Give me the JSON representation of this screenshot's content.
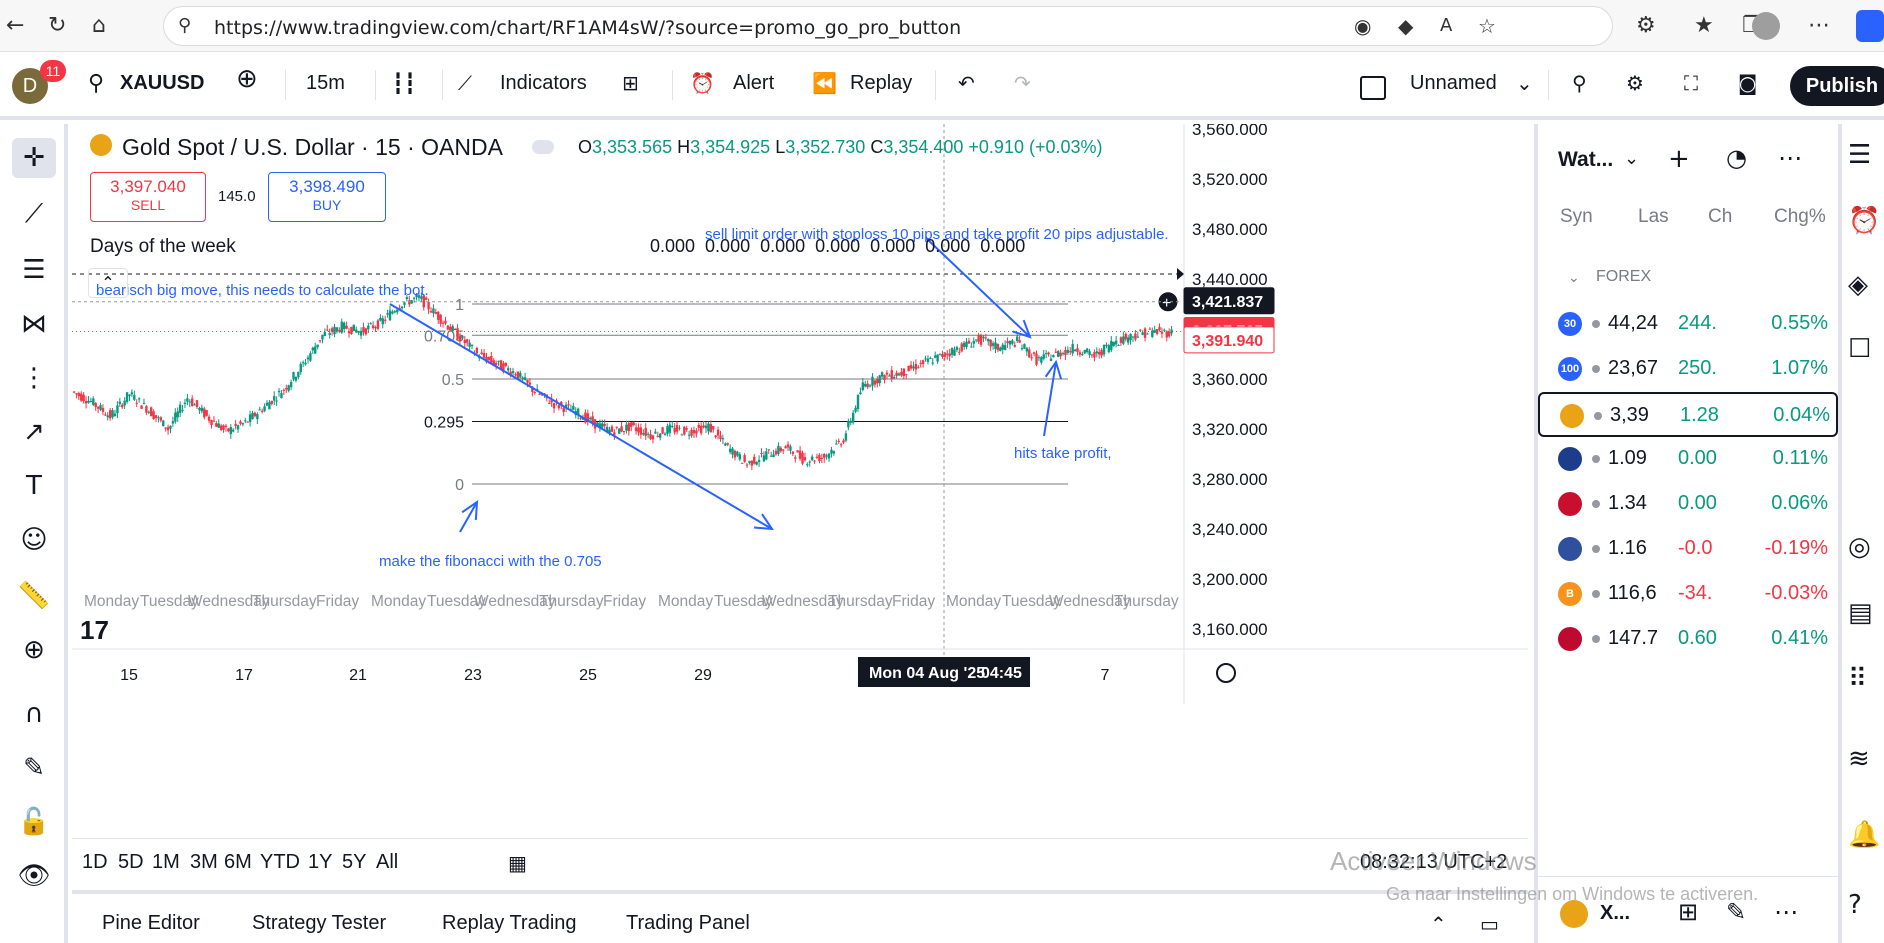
{
  "browser": {
    "url": "https://www.tradingview.com/chart/RF1AM4sW/?source=promo_go_pro_button"
  },
  "toolbar": {
    "avatar_letter": "D",
    "avatar_badge": "11",
    "symbol": "XAUUSD",
    "interval": "15m",
    "indicators_label": "Indicators",
    "alert_label": "Alert",
    "replay_label": "Replay",
    "layout_name": "Unnamed",
    "publish_label": "Publish"
  },
  "legend": {
    "title": "Gold Spot / U.S. Dollar · 15 · OANDA",
    "o_label": "O",
    "o_value": "3,353.565",
    "h_label": "H",
    "h_value": "3,354.925",
    "l_label": "L",
    "l_value": "3,352.730",
    "c_label": "C",
    "c_value": "3,354.400",
    "change": "+0.910 (+0.03%)",
    "sell_price": "3,397.040",
    "sell_label": "SELL",
    "spread": "145.0",
    "buy_price": "3,398.490",
    "buy_label": "BUY",
    "indicator_name": "Days of the week",
    "indicator_values": "0.000  0.000  0.000  0.000  0.000  0.000  0.000"
  },
  "chart_data": {
    "type": "line",
    "title": "Gold Spot / U.S. Dollar · 15 · OANDA",
    "y_ticks": [
      "3,560.000",
      "3,520.000",
      "3,480.000",
      "3,440.000",
      "3,400.000",
      "3,360.000",
      "3,320.000",
      "3,280.000",
      "3,240.000",
      "3,200.000",
      "3,160.000"
    ],
    "x_ticks": [
      "15",
      "17",
      "21",
      "23",
      "25",
      "29",
      "7"
    ],
    "x_highlight": "Mon 04 Aug '25",
    "x_highlight_time": "04:45",
    "day_labels": [
      "Monday",
      "Tuesday",
      "Wednesday",
      "Thursday",
      "Friday",
      "Monday",
      "Tuesday",
      "Wednesday",
      "Thursday",
      "Friday",
      "Monday",
      "Tuesday",
      "Wednesday",
      "Thursday",
      "Friday",
      "Monday",
      "Tuesday",
      "Wednesday",
      "Thursday"
    ],
    "price_labels": {
      "crosshair": "3,421.837",
      "last": "3,397.765",
      "bid": "3,391.940"
    },
    "fib_levels": [
      {
        "label": "1",
        "value": 3420
      },
      {
        "label": "0.705",
        "value": 3395
      },
      {
        "label": "0.5",
        "value": 3360
      },
      {
        "label": "0.295",
        "value": 3326
      },
      {
        "label": "0",
        "value": 3276
      }
    ],
    "approx_close_series": [
      3350,
      3342,
      3330,
      3348,
      3335,
      3320,
      3345,
      3330,
      3318,
      3325,
      3338,
      3352,
      3372,
      3395,
      3402,
      3398,
      3405,
      3420,
      3425,
      3410,
      3395,
      3380,
      3372,
      3365,
      3350,
      3340,
      3335,
      3325,
      3318,
      3322,
      3315,
      3320,
      3318,
      3322,
      3305,
      3292,
      3300,
      3305,
      3295,
      3298,
      3312,
      3355,
      3362,
      3365,
      3372,
      3378,
      3385,
      3392,
      3385,
      3390,
      3375,
      3380,
      3385,
      3378,
      3390,
      3395,
      3398,
      3397
    ]
  },
  "annotations": {
    "bearish": "bearisch big move, this needs to calculate the bot.",
    "sell_limit": "sell limit order with stoploss 10 pips and take profit 20 pips  adjustable.",
    "take_profit": "hits take profit,",
    "fibonacci": "make the fibonacci with the 0.705"
  },
  "timeframes": [
    "1D",
    "5D",
    "1M",
    "3M",
    "6M",
    "YTD",
    "1Y",
    "5Y",
    "All"
  ],
  "clock": "08:32:13 UTC+2",
  "bottom_tabs": [
    "Pine Editor",
    "Strategy Tester",
    "Replay Trading",
    "Trading Panel"
  ],
  "watchlist": {
    "title": "Wat...",
    "columns": [
      "Syn",
      "Las",
      "Ch",
      "Chg%"
    ],
    "section": "FOREX",
    "rows": [
      {
        "badge": "30",
        "badge_color": "#2962ff",
        "last": "44,24",
        "chg": "244.",
        "chgp": "0.55%",
        "color": "#089981"
      },
      {
        "badge": "100",
        "badge_color": "#2962ff",
        "last": "23,67",
        "chg": "250.",
        "chgp": "1.07%",
        "color": "#089981"
      },
      {
        "badge": "",
        "badge_color": "#e8a317",
        "last": "3,39",
        "chg": "1.28",
        "chgp": "0.04%",
        "color": "#089981"
      },
      {
        "badge": "",
        "badge_color": "#1c3c8c",
        "last": "1.09",
        "chg": "0.00",
        "chgp": "0.11%",
        "color": "#089981"
      },
      {
        "badge": "",
        "badge_color": "#c8102e",
        "last": "1.34",
        "chg": "0.00",
        "chgp": "0.06%",
        "color": "#089981"
      },
      {
        "badge": "",
        "badge_color": "#2f4f9f",
        "last": "1.16",
        "chg": "-0.0",
        "chgp": "-0.19%",
        "color": "#f23645"
      },
      {
        "badge": "B",
        "badge_color": "#f7931a",
        "last": "116,6",
        "chg": "-34.",
        "chgp": "-0.03%",
        "color": "#f23645"
      },
      {
        "badge": "",
        "badge_color": "#bf0a30",
        "last": "147.7",
        "chg": "0.60",
        "chgp": "0.41%",
        "color": "#089981"
      }
    ],
    "footer_symbol": "X..."
  },
  "windows_watermark": {
    "line1": "Activeer Windows",
    "line2": "Ga naar Instellingen om Windows te activeren."
  },
  "colors": {
    "up": "#089981",
    "down": "#f23645",
    "annotation_blue": "#2962ff",
    "accent": "#2962ff"
  }
}
